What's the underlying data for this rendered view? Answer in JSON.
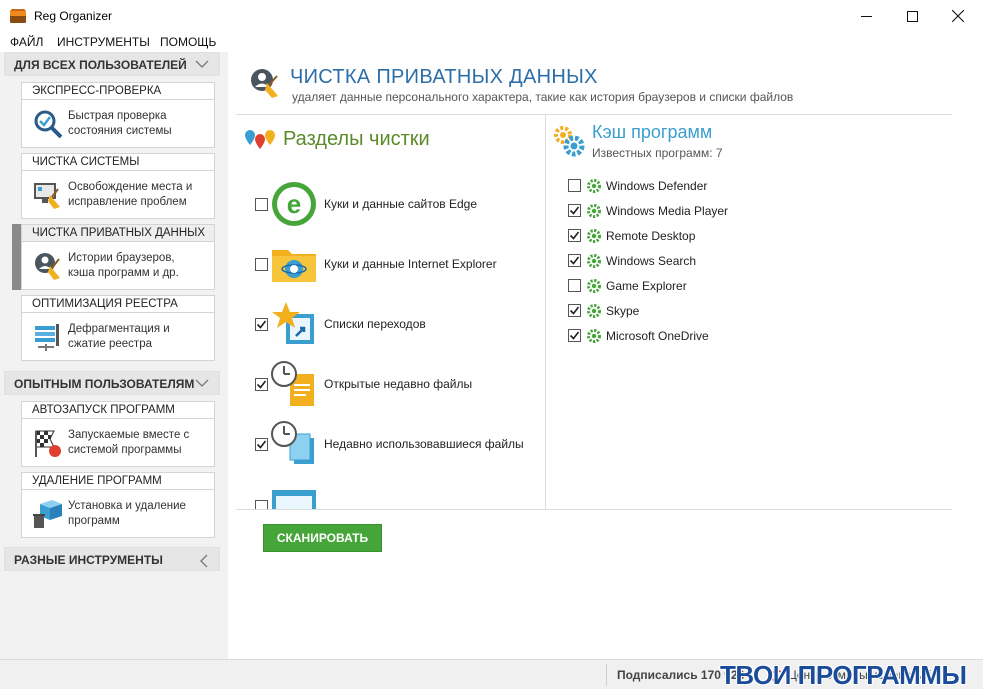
{
  "window": {
    "title": "Reg Organizer"
  },
  "menu": [
    "ФАЙЛ",
    "ИНСТРУМЕНТЫ",
    "ПОМОЩЬ"
  ],
  "sidebar": {
    "group_all": "ДЛЯ ВСЕХ ПОЛЬЗОВАТЕЛЕЙ",
    "group_expert": "ОПЫТНЫМ ПОЛЬЗОВАТЕЛЯМ",
    "group_misc": "РАЗНЫЕ ИНСТРУМЕНТЫ",
    "cards": [
      {
        "title": "ЭКСПРЕСС-ПРОВЕРКА",
        "desc1": "Быстрая проверка",
        "desc2": "состояния системы",
        "icon": "magnifier-check-icon"
      },
      {
        "title": "ЧИСТКА СИСТЕМЫ",
        "desc1": "Освобождение места и",
        "desc2": "исправление проблем",
        "icon": "monitor-broom-icon"
      },
      {
        "title": "ЧИСТКА ПРИВАТНЫХ ДАННЫХ",
        "desc1": "Истории браузеров,",
        "desc2": "кэша программ и др.",
        "icon": "privacy-broom-icon"
      },
      {
        "title": "ОПТИМИЗАЦИЯ РЕЕСТРА",
        "desc1": "Дефрагментация и",
        "desc2": "сжатие реестра",
        "icon": "registry-compress-icon"
      },
      {
        "title": "АВТОЗАПУСК ПРОГРАММ",
        "desc1": "Запускаемые вместе с",
        "desc2": "системой программы",
        "icon": "racing-flag-icon"
      },
      {
        "title": "УДАЛЕНИЕ ПРОГРАММ",
        "desc1": "Установка и удаление",
        "desc2": "программ",
        "icon": "box-trash-icon"
      }
    ]
  },
  "main": {
    "title": "ЧИСТКА ПРИВАТНЫХ ДАННЫХ",
    "subtitle": "удаляет данные персонального характера, такие как история браузеров и списки файлов",
    "sections_title": "Разделы чистки",
    "cache_title": "Кэш программ",
    "cache_known": "Известных программ: 7",
    "clean_items": [
      {
        "label": "Куки и данные сайтов Edge",
        "checked": false,
        "icon": "edge-icon"
      },
      {
        "label": "Куки и данные Internet Explorer",
        "checked": false,
        "icon": "ie-folder-icon"
      },
      {
        "label": "Списки переходов",
        "checked": true,
        "icon": "star-shortcut-icon"
      },
      {
        "label": "Открытые недавно файлы",
        "checked": true,
        "icon": "clock-document-icon"
      },
      {
        "label": "Недавно использовавшиеся файлы",
        "checked": true,
        "icon": "clock-files-icon"
      }
    ],
    "programs": [
      {
        "label": "Windows Defender",
        "checked": false
      },
      {
        "label": "Windows Media Player",
        "checked": true
      },
      {
        "label": "Remote Desktop",
        "checked": true
      },
      {
        "label": "Windows Search",
        "checked": true
      },
      {
        "label": "Game Explorer",
        "checked": false
      },
      {
        "label": "Skype",
        "checked": true
      },
      {
        "label": "Microsoft OneDrive",
        "checked": true
      }
    ],
    "scan_button": "СКАНИРОВАТЬ"
  },
  "statusbar": {
    "subscribed": "Подписались 170 923",
    "undo_center": "Центр отмены изменений",
    "watermark": "ТВОИ ПРОГРАММЫ РУ"
  },
  "colors": {
    "accent_blue": "#2c6fa8",
    "section_green": "#5a8a2a",
    "scan_green": "#45a538",
    "cache_blue": "#3a9fd0"
  }
}
